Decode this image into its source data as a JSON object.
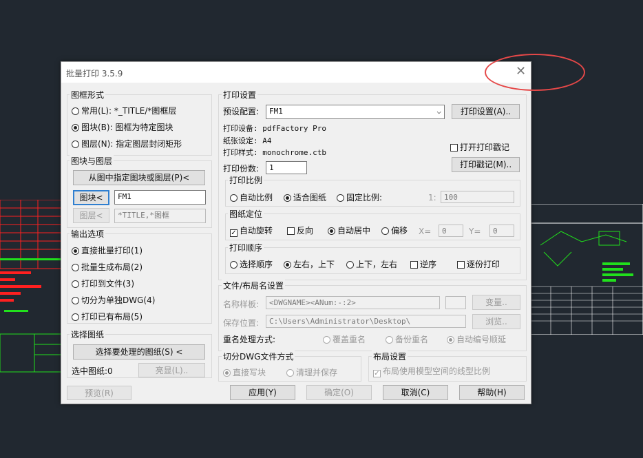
{
  "dialog": {
    "title": "批量打印 3.5.9",
    "close": "✕"
  },
  "frame_style": {
    "legend": "图框形式",
    "options": [
      "常用(L): *_TITLE/*图框层",
      "图块(B): 图框为特定图块",
      "图层(N): 指定图层封闭矩形"
    ],
    "selected": 1
  },
  "block_layer": {
    "legend": "图块与图层",
    "pick_button": "从图中指定图块或图层(P)<",
    "block_button": "图块<",
    "block_value": "FM1",
    "layer_button": "图层<",
    "layer_value": "*TITLE,*图框"
  },
  "output": {
    "legend": "输出选项",
    "options": [
      "直接批量打印(1)",
      "批量生成布局(2)",
      "打印到文件(3)",
      "切分为单独DWG(4)",
      "打印已有布局(5)"
    ],
    "selected": 0
  },
  "select_drawings": {
    "legend": "选择图纸",
    "button": "选择要处理的图纸(S) <",
    "count_label": "选中图纸:0",
    "highlight_button": "亮显(L)..",
    "preview_button": "预览(R)"
  },
  "print_settings": {
    "legend": "打印设置",
    "preset_label": "预设配置:",
    "preset_value": "FM1",
    "setup_button": "打印设置(A)..",
    "device": "打印设备: pdfFactory Pro",
    "paper": "纸张设定: A4",
    "style": "打印样式: monochrome.ctb",
    "stamp_checkbox": "打开打印戳记",
    "stamp_button": "打印戳记(M)..",
    "copies_label": "打印份数:",
    "copies_value": "1"
  },
  "scale": {
    "legend": "打印比例",
    "options": [
      "自动比例",
      "适合图纸",
      "固定比例:"
    ],
    "selected": 1,
    "ratio_label": "1:",
    "ratio_value": "100"
  },
  "position": {
    "legend": "图纸定位",
    "auto_rotate": "自动旋转",
    "reverse": "反向",
    "center": "自动居中",
    "offset": "偏移",
    "x_label": "X=",
    "x_value": "0",
    "y_label": "Y=",
    "y_value": "0"
  },
  "order": {
    "legend": "打印顺序",
    "options": [
      "选择顺序",
      "左右，上下",
      "上下，左右"
    ],
    "selected": 1,
    "reverse": "逆序",
    "copies": "逐份打印"
  },
  "file_layout": {
    "legend": "文件/布局名设置",
    "name_label": "名称样板:",
    "name_value": "<DWGNAME><ANum:-:2>",
    "vary_button": "变量..",
    "path_label": "保存位置:",
    "path_value": "C:\\Users\\Administrator\\Desktop\\",
    "browse_button": "浏览..",
    "rename_label": "重名处理方式:",
    "rename_options": [
      "覆盖重名",
      "备份重名",
      "自动编号顺延"
    ],
    "rename_selected": 2
  },
  "split": {
    "legend": "切分DWG文件方式",
    "options": [
      "直接写块",
      "清理并保存"
    ],
    "selected": 0
  },
  "layout": {
    "legend": "布局设置",
    "checkbox": "布局使用模型空间的线型比例"
  },
  "footer": {
    "apply": "应用(Y)",
    "ok": "确定(O)",
    "cancel": "取消(C)",
    "help": "帮助(H)"
  },
  "colors": {
    "accent": "#2f7fd0",
    "annotation": "#e54848",
    "cad_bg": "#212830",
    "cad_red": "#ff2020",
    "cad_green": "#21e01c"
  }
}
